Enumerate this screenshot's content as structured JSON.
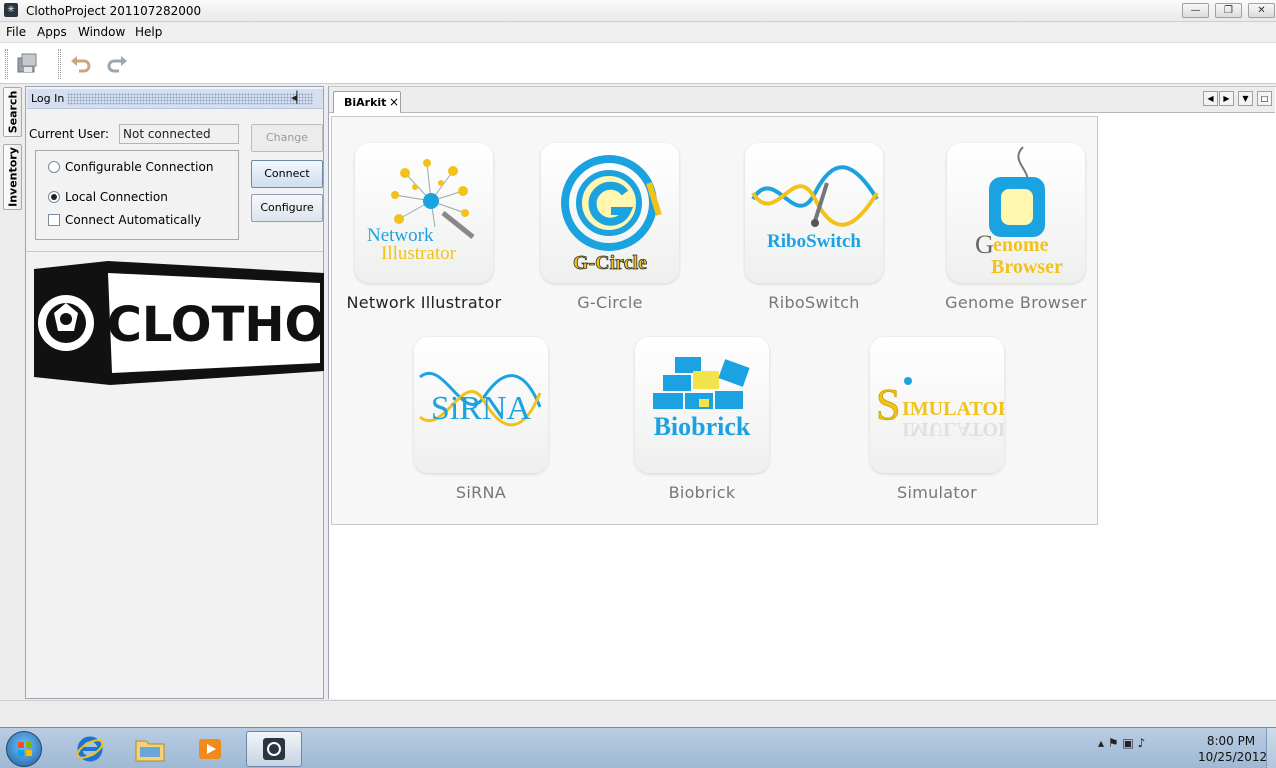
{
  "window": {
    "title": "ClothoProject 201107282000",
    "minimize": "—",
    "restore": "❐",
    "close": "✕"
  },
  "menu": [
    "File",
    "Apps",
    "Window",
    "Help"
  ],
  "side_tabs": [
    "Search",
    "Inventory"
  ],
  "login": {
    "header": "Log In",
    "collapse_glyph": "◂▏",
    "current_user_label": "Current User:",
    "current_user_value": "Not connected",
    "configurable_label": "Configurable Connection",
    "local_label": "Local Connection",
    "auto_label": "Connect Automatically",
    "selected": "local",
    "auto_connect": false,
    "change_button": "Change",
    "connect_button": "Connect",
    "configure_button": "Configure",
    "logo_text": "CLOTHO"
  },
  "main": {
    "tab_label": "BiArkit",
    "tab_close": "×",
    "nav": [
      "◀",
      "▶",
      "▼",
      "□"
    ],
    "apps": [
      {
        "name": "Network Illustrator",
        "logo_line1": "Network",
        "logo_line2": "Illustrator"
      },
      {
        "name": "G-Circle",
        "logo_line1": "G-Circle"
      },
      {
        "name": "RiboSwitch",
        "logo_line1": "RiboSwitch"
      },
      {
        "name": "Genome Browser",
        "logo_line1": "enome",
        "logo_line2": "Browser"
      },
      {
        "name": "SiRNA",
        "logo_line1": "SiRNA"
      },
      {
        "name": "Biobrick",
        "logo_line1": "Biobrick"
      },
      {
        "name": "Simulator",
        "logo_line1": "IMULATOR"
      }
    ]
  },
  "taskbar": {
    "tray_glyphs": "▴  ⚑  ▣  ♪",
    "time": "8:00 PM",
    "date": "10/25/2012"
  },
  "colors": {
    "brand_blue": "#1aa3e0",
    "brand_yellow": "#f2c21b",
    "panel_border": "#9aa6b3"
  }
}
